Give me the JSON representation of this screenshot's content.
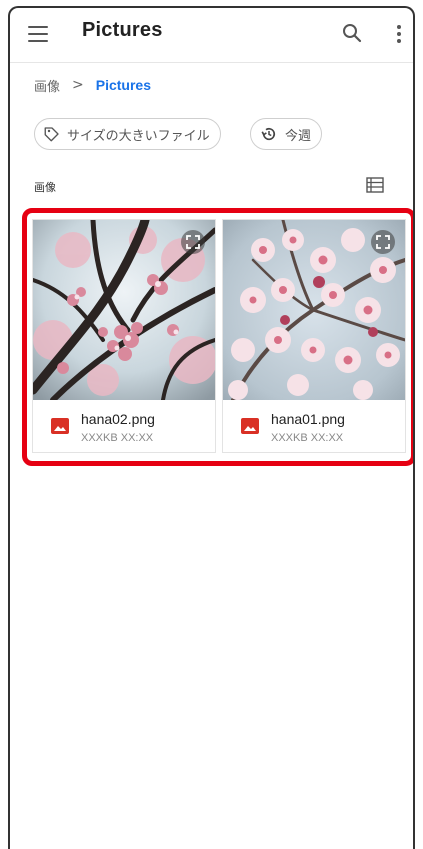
{
  "appbar": {
    "title": "Pictures",
    "menu_icon": "menu-icon",
    "search_icon": "search-icon",
    "more_icon": "more-vert-icon"
  },
  "breadcrumb": {
    "root": "画像",
    "separator": ">",
    "current": "Pictures"
  },
  "chips": [
    {
      "label": "サイズの大きいファイル",
      "icon": "tag-icon"
    },
    {
      "label": "今週",
      "icon": "history-icon"
    }
  ],
  "section": {
    "label": "画像",
    "view_toggle_icon": "list-view-icon"
  },
  "files": [
    {
      "name": "hana02.png",
      "meta": "XXXKB XX:XX",
      "icon": "image-file-icon"
    },
    {
      "name": "hana01.png",
      "meta": "XXXKB XX:XX",
      "icon": "image-file-icon"
    }
  ],
  "colors": {
    "accent": "#1a73e8",
    "highlight": "#e60012",
    "file_icon": "#d93025"
  }
}
